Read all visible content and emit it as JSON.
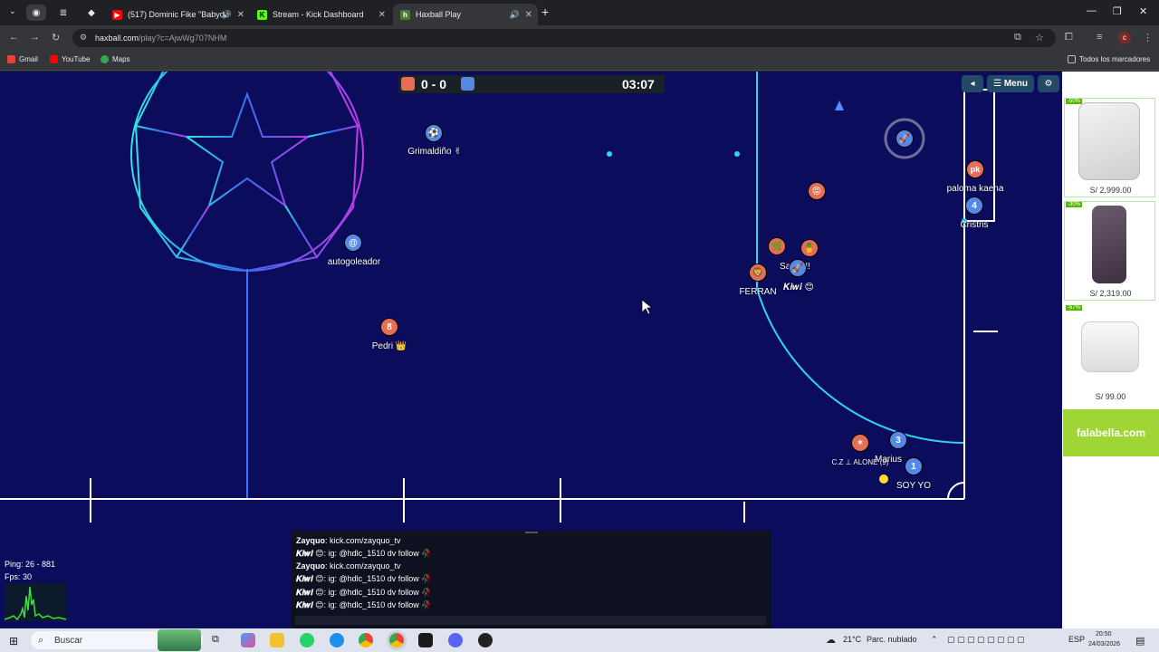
{
  "browser": {
    "tabs": [
      {
        "title": "(517) Dominic Fike \"Babydo",
        "favicon_color": "#ff0000",
        "favicon": "youtube-icon"
      },
      {
        "title": "Stream - Kick Dashboard",
        "favicon_color": "#53fc18",
        "favicon": "kick-icon"
      },
      {
        "title": "Haxball Play",
        "favicon_color": "#4a7a33",
        "favicon": "haxball-icon"
      }
    ],
    "url_host": "haxball.com",
    "url_path": "/play?c=AjwWg707NHM",
    "bookmarks": [
      "Gmail",
      "YouTube",
      "Maps"
    ],
    "all_bookmarks": "Todos los marcadores",
    "profile_initial": "c"
  },
  "game": {
    "score": "0 - 0",
    "timer": "03:07",
    "menu_label": "Menu",
    "red_color": "#e56e56",
    "blue_color": "#5689e5",
    "players": [
      {
        "name": "Grimaldiño ✌",
        "team": "blue",
        "avatar": "⚽"
      },
      {
        "name": "autogoleador",
        "team": "blue",
        "avatar": "@"
      },
      {
        "name": "Pedri 👑",
        "team": "red",
        "avatar": "8"
      },
      {
        "name": "paloma kaena",
        "team": "red",
        "avatar": "pk"
      },
      {
        "name": "Cristris",
        "team": "blue",
        "avatar": "4"
      },
      {
        "name": "Santi !!!",
        "team": "red",
        "avatar": "🏆"
      },
      {
        "name": "FERRAN",
        "team": "red",
        "avatar": "🦁"
      },
      {
        "name": "𝑲𝒊𝒘𝒊 😊",
        "team": "blue",
        "avatar": "🚀"
      },
      {
        "name": "C.Z ⊥ ALONE (9)",
        "team": "red",
        "avatar": "✶"
      },
      {
        "name": "Marius",
        "team": "blue",
        "avatar": "3"
      },
      {
        "name": "SOY YO",
        "team": "blue",
        "avatar": "1"
      }
    ],
    "chat": [
      {
        "author": "Zayquo",
        "text": "kick.com/zayquo_tv"
      },
      {
        "author": "𝑲𝒊𝒘𝒊 😊",
        "text": "ig: @hdlc_1510 dv follow 🥀"
      },
      {
        "author": "Zayquo",
        "text": "kick.com/zayquo_tv"
      },
      {
        "author": "𝑲𝒊𝒘𝒊 😊",
        "text": "ig: @hdlc_1510 dv follow 🥀"
      },
      {
        "author": "𝑲𝒊𝒘𝒊 😊",
        "text": "ig: @hdlc_1510 dv follow 🥀"
      },
      {
        "author": "𝑲𝒊𝒘𝒊 😊",
        "text": "ig: @hdlc_1510 dv follow 🥀"
      }
    ],
    "ping": "Ping: 26 - 881",
    "fps": "Fps: 30"
  },
  "ads": {
    "items": [
      {
        "badge": "-50%",
        "price": "S/ 2,999.00"
      },
      {
        "badge": "-30%",
        "price": "S/ 2,319.00"
      },
      {
        "badge": "-67%",
        "price": "S/ 99.00"
      }
    ],
    "brand": "falabella.com"
  },
  "taskbar": {
    "search_placeholder": "Buscar",
    "weather": "21°C",
    "weather_desc": "Parc. nublado",
    "lang": "ESP",
    "time": "20:50",
    "date": "24/03/2026"
  }
}
